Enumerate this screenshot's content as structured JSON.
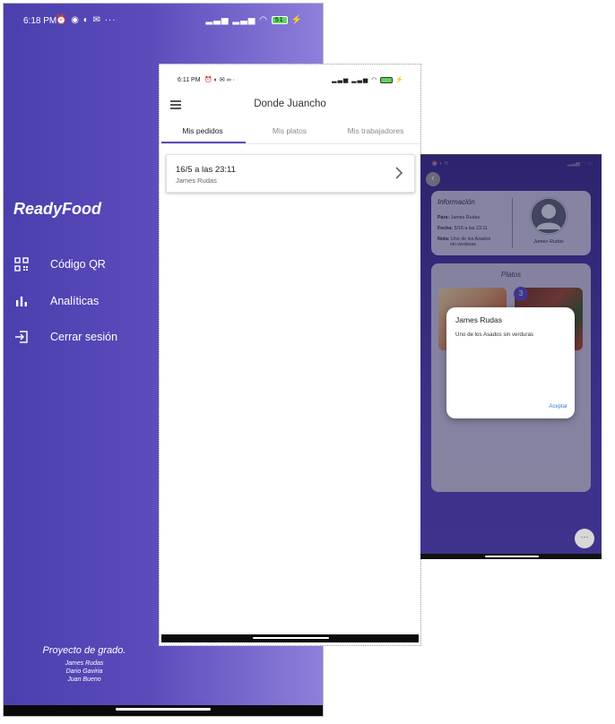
{
  "left_screen": {
    "status": {
      "time": "6:18 PM",
      "icons_left": "⏰ ◉ ◐ ✉ ···",
      "icons_right": "▂▃▅ ▂▃▅ ◠",
      "battery": "51"
    },
    "brand": "ReadyFood",
    "menu": [
      {
        "label": "Código QR",
        "icon": "qr-code-icon"
      },
      {
        "label": "Analíticas",
        "icon": "bar-chart-icon"
      },
      {
        "label": "Cerrar sesión",
        "icon": "logout-icon"
      }
    ],
    "footer": {
      "title": "Proyecto de grado.",
      "names": [
        "James Rudas",
        "Dario Gaviria",
        "Juan Bueno"
      ]
    }
  },
  "middle_screen": {
    "status": {
      "time": "6:11 PM",
      "icons_left": "⏰ ◐ ✉ ∞ ·",
      "icons_right": "▂▃▅ ▂▃▅ ◠",
      "battery": ""
    },
    "title": "Donde Juancho",
    "tabs": [
      {
        "label": "Mis pedidos",
        "active": true
      },
      {
        "label": "Mis platos",
        "active": false
      },
      {
        "label": "Mis trabajadores",
        "active": false
      }
    ],
    "orders": [
      {
        "title": "16/5 a las 23:11",
        "subtitle": "James Rudas"
      }
    ]
  },
  "right_screen": {
    "info": {
      "title": "Información",
      "para_label": "Para:",
      "para_value": "James Rudas",
      "fecha_label": "Fecha:",
      "fecha_value": "5/16 a las 23:11",
      "nota_label": "Nota:",
      "nota_value_1": "Uno de los Asados",
      "nota_value_2": "sin verduras",
      "avatar_name": "James Rudas"
    },
    "platos_title": "Platos",
    "badge": "3",
    "dialog": {
      "title": "James Rudas",
      "body": "Uno de los Asados sin verduras",
      "accept": "Aceptar"
    },
    "fab_label": "···"
  }
}
